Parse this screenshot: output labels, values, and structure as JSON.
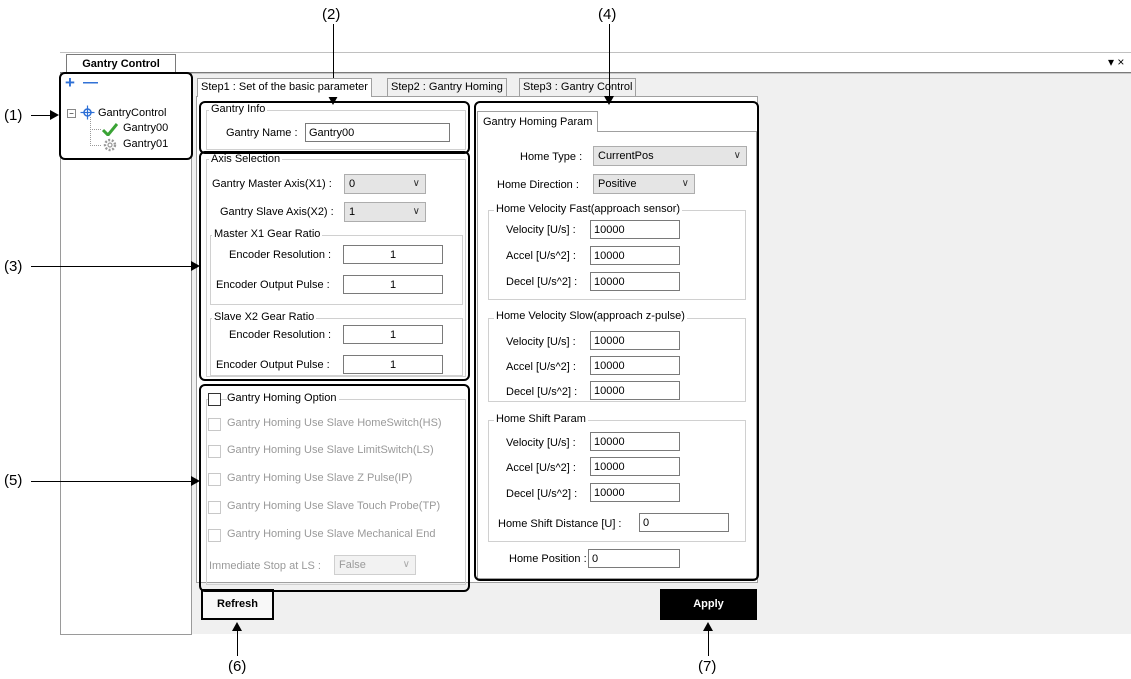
{
  "callouts": [
    "(1)",
    "(2)",
    "(3)",
    "(4)",
    "(5)",
    "(6)",
    "(7)"
  ],
  "window": {
    "doc_tab": "Gantry Control",
    "controls": "▾ ×"
  },
  "tree": {
    "add": "+",
    "remove": "—",
    "root": "GantryControl",
    "items": [
      "Gantry00",
      "Gantry01"
    ]
  },
  "tabs": [
    "Step1 : Set of the basic parameter",
    "Step2 : Gantry Homing",
    "Step3 : Gantry Control"
  ],
  "gantry_info": {
    "title": "Gantry Info",
    "name_label": "Gantry Name :",
    "name_value": "Gantry00"
  },
  "axis_selection": {
    "title": "Axis Selection",
    "master_label": "Gantry Master Axis(X1) :",
    "master_value": "0",
    "slave_label": "Gantry Slave Axis(X2) :",
    "slave_value": "1",
    "master_gear": {
      "title": "Master X1 Gear Ratio",
      "res_label": "Encoder Resolution :",
      "res_value": "1",
      "pulse_label": "Encoder Output Pulse :",
      "pulse_value": "1"
    },
    "slave_gear": {
      "title": "Slave X2 Gear Ratio",
      "res_label": "Encoder Resolution :",
      "res_value": "1",
      "pulse_label": "Encoder Output Pulse :",
      "pulse_value": "1"
    }
  },
  "homing_option": {
    "title": "Gantry Homing Option",
    "options": [
      "Gantry Homing Use Slave HomeSwitch(HS)",
      "Gantry Homing Use Slave LimitSwitch(LS)",
      "Gantry Homing Use Slave Z Pulse(IP)",
      "Gantry Homing Use Slave Touch Probe(TP)",
      "Gantry Homing Use Slave Mechanical End"
    ],
    "stop_label": "Immediate Stop at LS :",
    "stop_value": "False"
  },
  "homing_param": {
    "tab": "Gantry Homing Param",
    "home_type_label": "Home Type :",
    "home_type_value": "CurrentPos",
    "home_dir_label": "Home Direction :",
    "home_dir_value": "Positive",
    "fast": {
      "title": "Home Velocity Fast(approach sensor)",
      "vel_label": "Velocity [U/s] :",
      "vel": "10000",
      "acc_label": "Accel [U/s^2] :",
      "acc": "10000",
      "dec_label": "Decel [U/s^2] :",
      "dec": "10000"
    },
    "slow": {
      "title": "Home Velocity Slow(approach z-pulse)",
      "vel_label": "Velocity [U/s] :",
      "vel": "10000",
      "acc_label": "Accel [U/s^2] :",
      "acc": "10000",
      "dec_label": "Decel [U/s^2] :",
      "dec": "10000"
    },
    "shift": {
      "title": "Home Shift Param",
      "vel_label": "Velocity [U/s] :",
      "vel": "10000",
      "acc_label": "Accel [U/s^2] :",
      "acc": "10000",
      "dec_label": "Decel [U/s^2] :",
      "dec": "10000",
      "dist_label": "Home Shift Distance [U] :",
      "dist": "0"
    },
    "pos_label": "Home Position :",
    "pos_value": "0"
  },
  "buttons": {
    "refresh": "Refresh",
    "apply": "Apply"
  },
  "colors": {
    "apply_bg": "#000000",
    "apply_fg": "#ffffff",
    "check_green": "#3aa335"
  }
}
